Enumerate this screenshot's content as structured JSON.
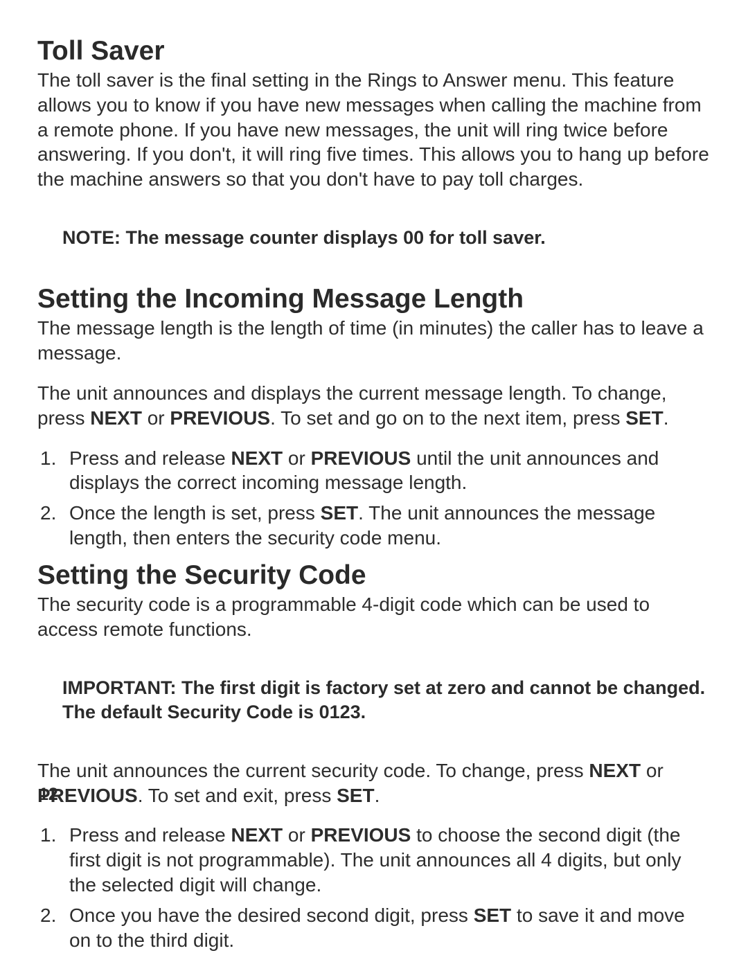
{
  "page_number": "12",
  "toll_saver": {
    "heading": "Toll Saver",
    "body": "The toll saver is the final setting in the Rings to Answer menu. This feature allows you to know if you have new messages when calling the machine from a remote phone. If you have new messages, the unit will ring twice before answering.  If you don't, it will ring five times. This allows you to hang up before the machine answers so that you don't have to pay toll charges.",
    "note": "NOTE: The message counter displays 00 for toll saver."
  },
  "msg_len": {
    "heading": "Setting the Incoming Message Length",
    "intro": "The message length is the length of time (in minutes) the caller has to leave a message.",
    "announce_pre": "The unit announces and displays the current message length. To change, press ",
    "kw_next": "NEXT",
    "announce_mid1": " or ",
    "kw_prev": "PREVIOUS",
    "announce_mid2": ". To set and go on to the next item, press ",
    "kw_set": "SET",
    "announce_post": ".",
    "step1_pre": "Press and release ",
    "step1_mid": " or ",
    "step1_post": " until the unit announces and displays the correct incoming message length.",
    "step2_pre": "Once the length is set, press ",
    "step2_post": ". The unit announces the message length, then enters the security code menu."
  },
  "sec_code": {
    "heading": "Setting the Security Code",
    "intro": "The security code is a programmable 4-digit code which can be used to access remote functions.",
    "important": "IMPORTANT: The first digit is factory set at zero and cannot be changed. The default Security Code is 0123.",
    "announce_pre": "The unit announces the current security code. To change, press ",
    "kw_next": "NEXT",
    "announce_mid1": " or ",
    "kw_prev": "PREVIOUS",
    "announce_mid2": ". To set and exit, press ",
    "kw_set": "SET",
    "announce_post": ".",
    "step1_pre": "Press and release ",
    "step1_mid": " or ",
    "step1_post": " to choose the second digit (the first digit is not programmable). The unit announces all 4 digits, but only the selected digit will change.",
    "step2_pre": "Once you have the desired second digit, press ",
    "step2_post": " to save it and move on to the third digit."
  }
}
